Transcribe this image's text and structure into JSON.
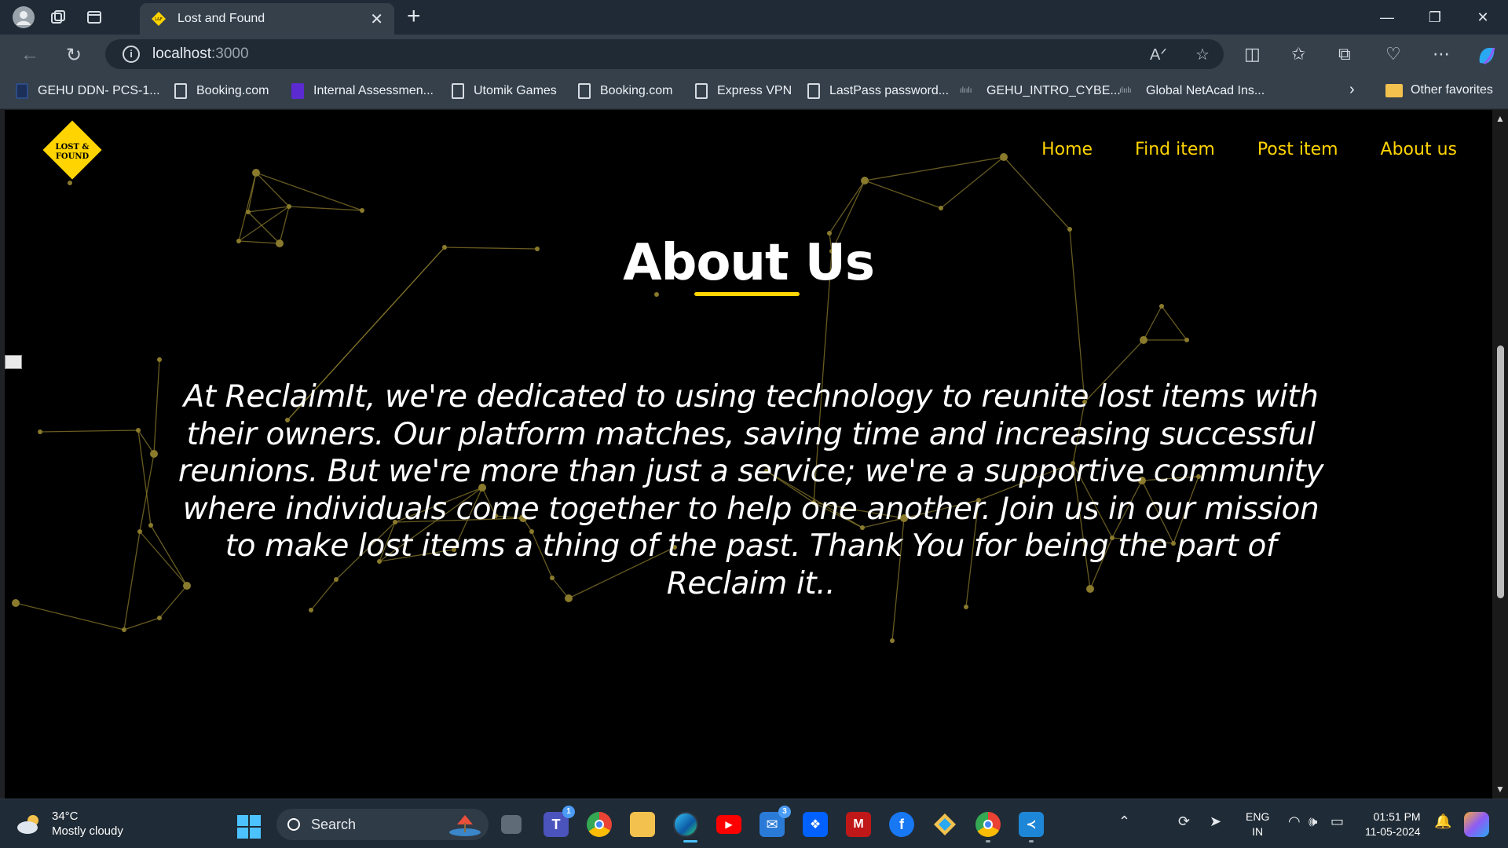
{
  "browser": {
    "tab": {
      "title": "Lost and Found"
    },
    "url": {
      "host": "localhost",
      "port": ":3000"
    },
    "bookmarks": [
      {
        "label": "GEHU DDN- PCS-1...",
        "icon": "blank-dark"
      },
      {
        "label": "Booking.com",
        "icon": "page"
      },
      {
        "label": "Internal Assessmen...",
        "icon": "purple-list"
      },
      {
        "label": "Utomik Games",
        "icon": "page"
      },
      {
        "label": "Booking.com",
        "icon": "page"
      },
      {
        "label": "Express VPN",
        "icon": "page"
      },
      {
        "label": "LastPass password...",
        "icon": "page"
      },
      {
        "label": "GEHU_INTRO_CYBE...",
        "icon": "cisco"
      },
      {
        "label": "Global NetAcad Ins...",
        "icon": "cisco"
      }
    ],
    "other_favorites": "Other favorites"
  },
  "site": {
    "logo_text": [
      "LOST &",
      "FOUND"
    ],
    "nav": [
      "Home",
      "Find item",
      "Post item",
      "About us"
    ],
    "title": "About Us",
    "body": "At ReclaimIt, we're dedicated to using technology to reunite lost items with their owners. Our platform matches, saving time and increasing successful reunions. But we're more than just a service; we're a supportive community where individuals come together to help one another. Join us in our mission to make lost items a thing of the past. Thank You for being the part of Reclaim it..",
    "accent": "#ffd400",
    "network_color": "#8a7a2c"
  },
  "taskbar": {
    "weather": {
      "temp": "34°C",
      "desc": "Mostly cloudy"
    },
    "search_label": "Search",
    "badges": {
      "teams": "1",
      "mail": "3"
    },
    "lang": [
      "ENG",
      "IN"
    ],
    "time": "01:51 PM",
    "date": "11-05-2024"
  }
}
